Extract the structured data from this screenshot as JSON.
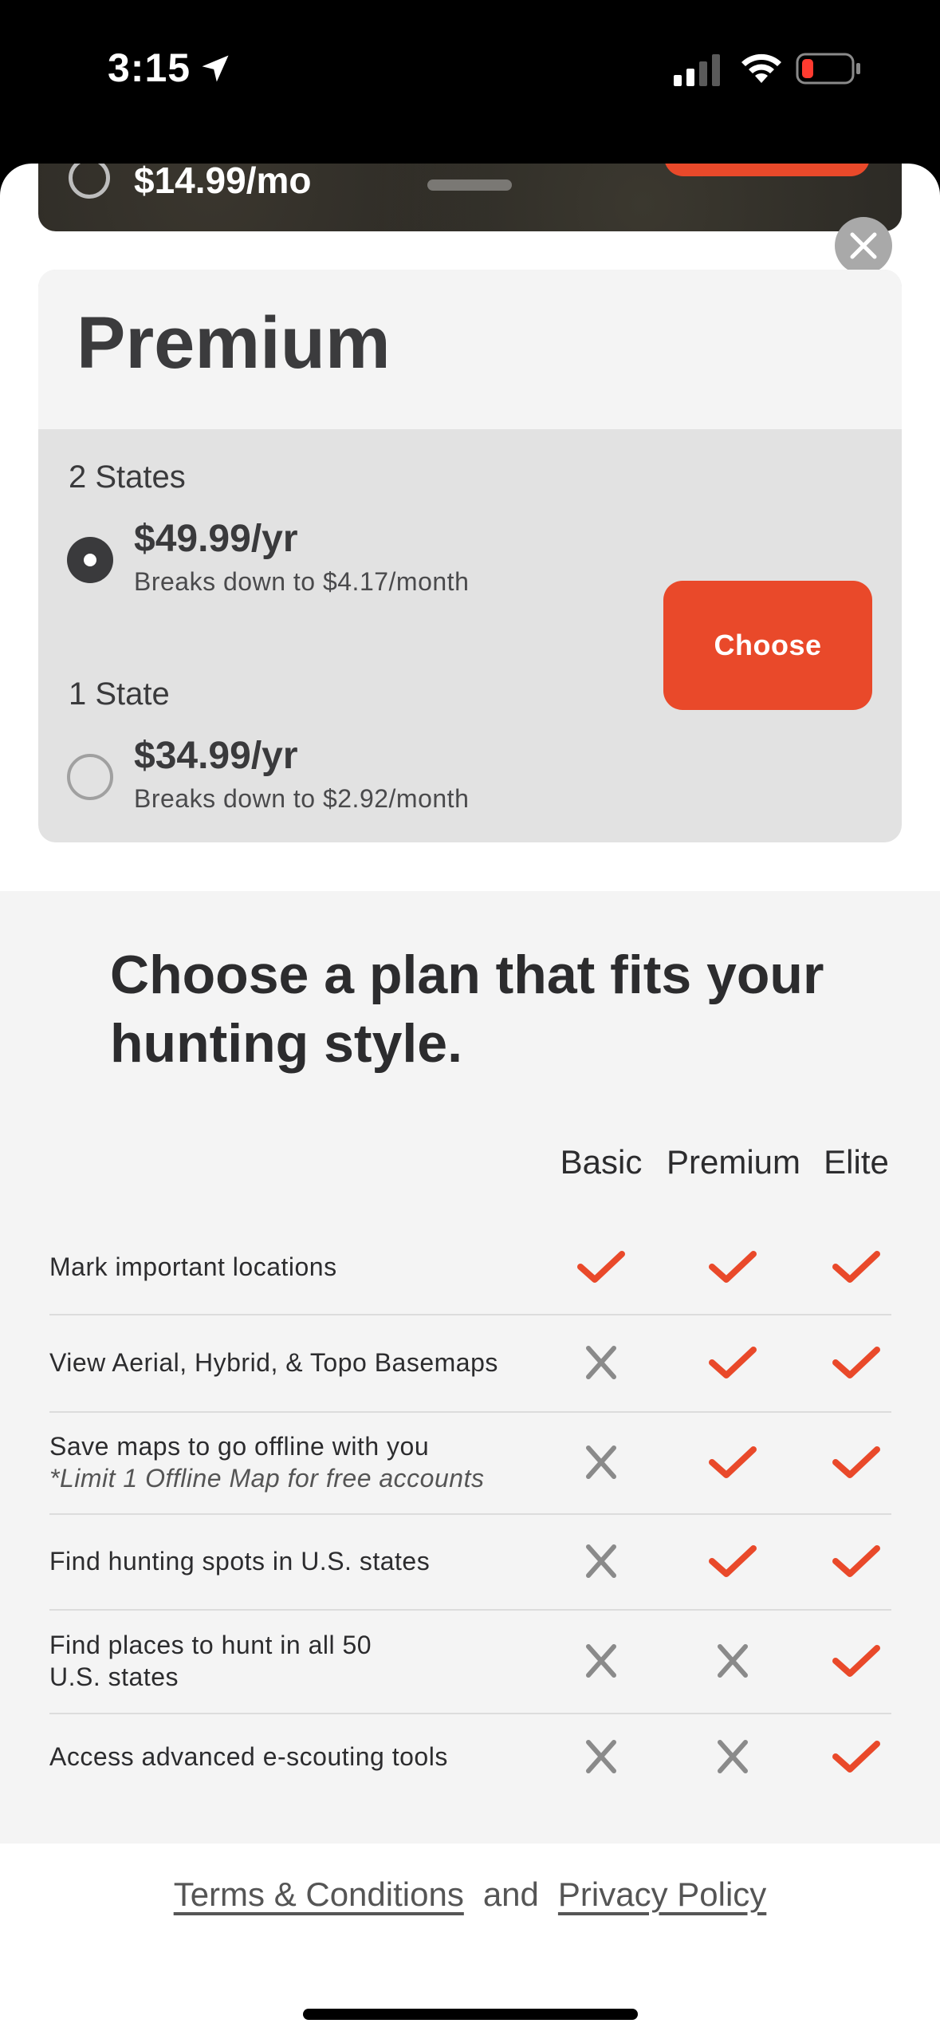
{
  "status_bar": {
    "time": "3:15",
    "icons": [
      "location-arrow-icon",
      "cellular-signal-icon",
      "wifi-icon",
      "battery-low-icon"
    ]
  },
  "top_plan": {
    "price": "$14.99/mo"
  },
  "premium": {
    "title": "Premium",
    "options": [
      {
        "label": "2 States",
        "price": "$49.99/yr",
        "sub": "Breaks down to $4.17/month",
        "selected": true
      },
      {
        "label": "1 State",
        "price": "$34.99/yr",
        "sub": "Breaks down to $2.92/month",
        "selected": false
      }
    ],
    "choose_label": "Choose"
  },
  "comparison": {
    "title": "Choose a plan that fits your hunting style.",
    "columns": [
      "Basic",
      "Premium",
      "Elite"
    ],
    "rows": [
      {
        "feature": "Mark important locations",
        "note": "",
        "basic": true,
        "premium": true,
        "elite": true
      },
      {
        "feature": "View Aerial, Hybrid, & Topo Basemaps",
        "note": "",
        "basic": false,
        "premium": true,
        "elite": true
      },
      {
        "feature": "Save maps to go offline with you",
        "note": "*Limit 1 Offline Map for free accounts",
        "basic": false,
        "premium": true,
        "elite": true
      },
      {
        "feature": "Find hunting spots in U.S. states",
        "note": "",
        "basic": false,
        "premium": true,
        "elite": true
      },
      {
        "feature": "Find places to hunt in all 50 U.S. states",
        "note": "",
        "basic": false,
        "premium": false,
        "elite": true
      },
      {
        "feature": "Access advanced e-scouting tools",
        "note": "",
        "basic": false,
        "premium": false,
        "elite": true
      }
    ]
  },
  "footer": {
    "terms": "Terms & Conditions",
    "and": "and",
    "privacy": "Privacy Policy"
  },
  "colors": {
    "accent": "#e9492a",
    "check": "#e9492a",
    "cross": "#8a8a8a"
  }
}
